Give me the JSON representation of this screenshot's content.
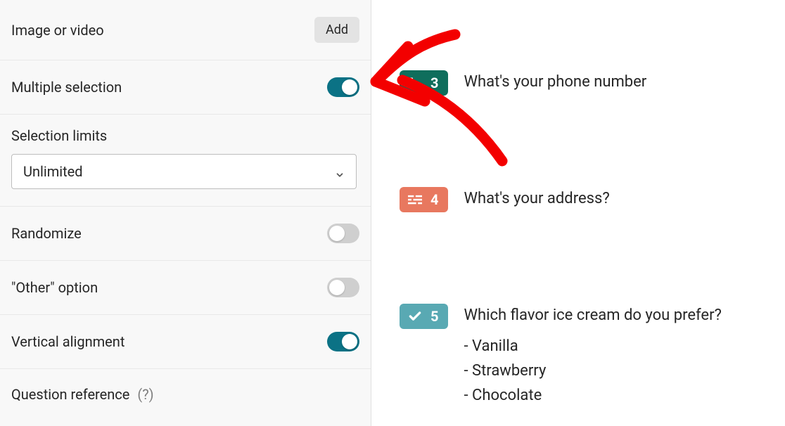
{
  "sidebar": {
    "image_video": {
      "label": "Image or video",
      "button": "Add"
    },
    "multiple_selection": {
      "label": "Multiple selection",
      "on": true
    },
    "selection_limits": {
      "label": "Selection limits",
      "value": "Unlimited"
    },
    "randomize": {
      "label": "Randomize",
      "on": false
    },
    "other_option": {
      "label": "\"Other\" option",
      "on": false
    },
    "vertical_alignment": {
      "label": "Vertical alignment",
      "on": true
    },
    "question_reference": {
      "label": "Question reference",
      "help": "(?)"
    }
  },
  "questions": [
    {
      "number": "3",
      "text": "What's your phone number",
      "badge_color": "green",
      "icon": "phone"
    },
    {
      "number": "4",
      "text": "What's your address?",
      "badge_color": "salmon",
      "icon": "address"
    },
    {
      "number": "5",
      "text": "Which flavor ice cream do you prefer?",
      "badge_color": "teal",
      "icon": "check",
      "options": [
        "Vanilla",
        "Strawberry",
        "Chocolate"
      ]
    }
  ],
  "colors": {
    "accent": "#0b7285",
    "badge_green": "#0f6e5c",
    "badge_salmon": "#e8785f",
    "badge_teal": "#59a9b3",
    "annotation_red": "#f30000"
  }
}
